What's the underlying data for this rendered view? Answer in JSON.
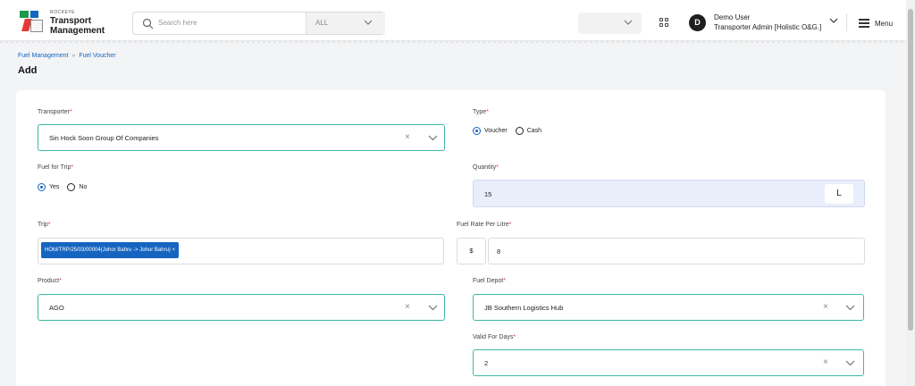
{
  "header": {
    "brand_top": "ROCKEYE",
    "brand_line1": "Transport",
    "brand_line2": "Management",
    "search_placeholder": "Search here",
    "search_scope": "ALL",
    "user_initial": "D",
    "user_name": "Demo User",
    "user_role": "Transporter Admin [Holistic O&G.]",
    "menu_label": "Menu"
  },
  "breadcrumb": {
    "item1": "Fuel Management",
    "item2": "Fuel Voucher"
  },
  "page_title": "Add",
  "form": {
    "transporter": {
      "label": "Transporter",
      "value": "Sin Hock Soon Group Of Companies"
    },
    "type": {
      "label": "Type",
      "options": [
        "Voucher",
        "Cash"
      ],
      "selected": "Voucher"
    },
    "fuel_for_trip": {
      "label": "Fuel for Trip",
      "options": [
        "Yes",
        "No"
      ],
      "selected": "Yes"
    },
    "quantity": {
      "label": "Quantity",
      "value": "15",
      "unit": "L"
    },
    "trip": {
      "label": "Trip",
      "tag": "HOM/TRP/25/03/00004(Johor Bahru -> Johor Bahru) ×"
    },
    "fuel_rate": {
      "label": "Fuel Rate Per Litre",
      "currency": "$",
      "value": "8"
    },
    "product": {
      "label": "Product",
      "value": "AGO"
    },
    "fuel_depot": {
      "label": "Fuel Depot",
      "value": "JB Southern Logistics Hub"
    },
    "valid_for_days": {
      "label": "Valid For Days",
      "value": "2"
    }
  },
  "icons": {
    "clear": "×"
  }
}
